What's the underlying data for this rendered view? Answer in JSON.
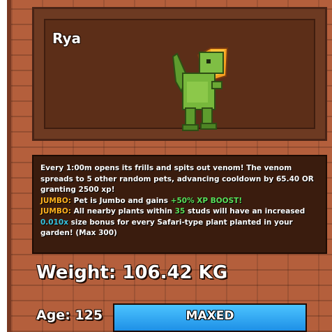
{
  "pet": {
    "name": "Rya",
    "sprite_icon": "green-dinosaur-pet-icon"
  },
  "description": {
    "line1": "Every 1:00m opens its frills and spits out venom! The venom spreads to 5 other random pets, advancing cooldown by 65.40 OR granting 2500 xp!",
    "jumbo_tag": "JUMBO:",
    "jumbo1_text": "Pet is Jumbo and gains",
    "jumbo1_boost": "+50% XP BOOST!",
    "jumbo2_pre": "All nearby plants within",
    "jumbo2_studs": "35",
    "jumbo2_mid": "studs will have an increased",
    "jumbo2_size": "0.010x",
    "jumbo2_post": "size bonus for every Safari-type plant planted in your garden! (Max 300)"
  },
  "stats": {
    "weight": "Weight: 106.42 KG",
    "age": "Age: 125",
    "xp_label": "MAXED",
    "xp_progress": 1.0
  },
  "colors": {
    "panel": "#b45f3c",
    "tag": "#ffb21e",
    "xp_bar": "#1e90e6"
  }
}
